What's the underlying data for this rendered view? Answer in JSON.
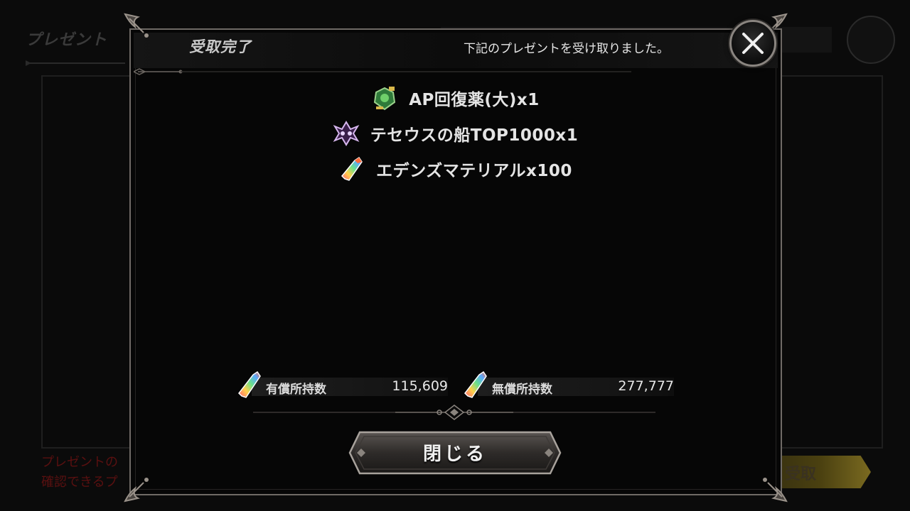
{
  "background": {
    "title": "プレゼント",
    "notice_line1": "プレゼントの",
    "notice_line2": "確認できるプ",
    "receive_button": "受取"
  },
  "modal": {
    "title": "受取完了",
    "message": "下記のプレゼントを受け取りました。",
    "close_icon": "close-x-icon",
    "rewards": [
      {
        "label": "AP回復薬(大)x1",
        "icon": "green-potion-icon"
      },
      {
        "label": "テセウスの船TOP1000x1",
        "icon": "purple-emblem-icon"
      },
      {
        "label": "エデンズマテリアルx100",
        "icon": "rainbow-crystal-icon"
      }
    ],
    "balances": {
      "paid_label": "有償所持数",
      "paid_value": "115,609",
      "free_label": "無償所持数",
      "free_value": "277,777"
    },
    "close_button_label": "閉じる"
  },
  "colors": {
    "frame": "#6f6a66",
    "accent_gold": "#7a6a20",
    "notice_red": "#5a1010"
  }
}
